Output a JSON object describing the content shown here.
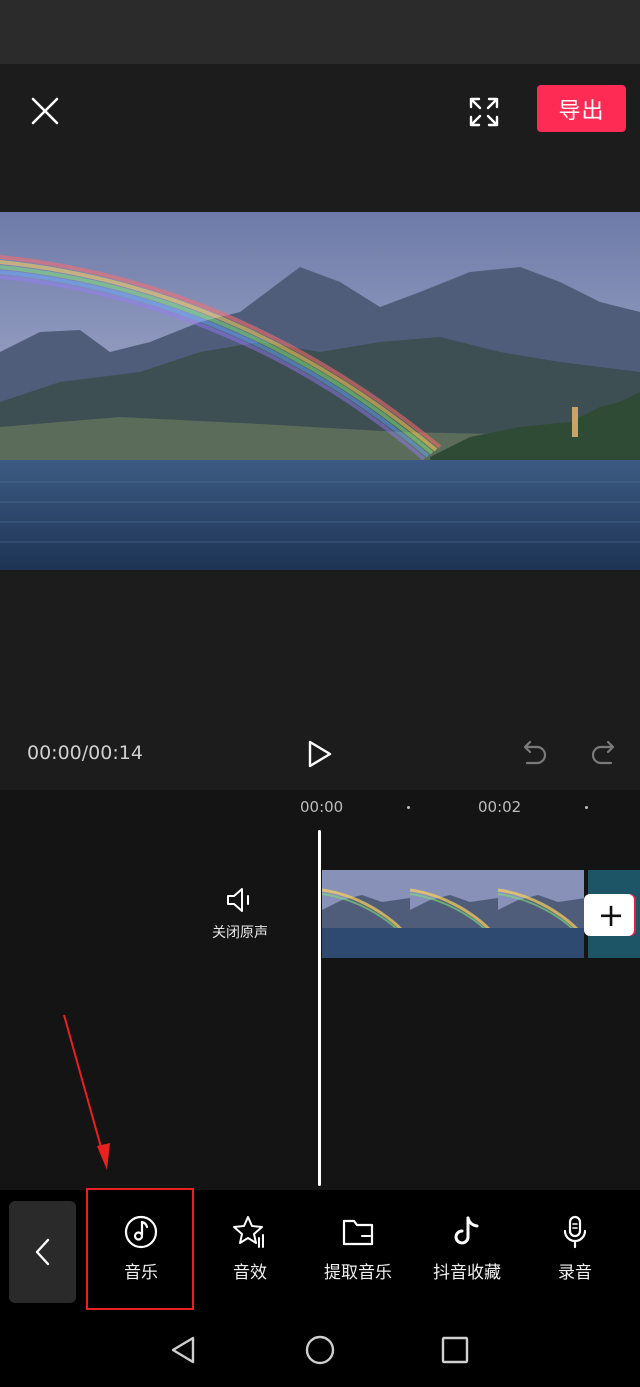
{
  "header": {
    "export_label": "导出"
  },
  "player": {
    "timecode": "00:00/00:14"
  },
  "timeline": {
    "ruler": [
      "00:00",
      "00:02"
    ],
    "mute_label": "关闭原声",
    "add_clip_label": "+"
  },
  "toolbar": {
    "items": [
      {
        "label": "音乐",
        "icon": "music-note-icon"
      },
      {
        "label": "音效",
        "icon": "sound-effect-icon"
      },
      {
        "label": "提取音乐",
        "icon": "folder-icon"
      },
      {
        "label": "抖音收藏",
        "icon": "tiktok-icon"
      },
      {
        "label": "录音",
        "icon": "microphone-icon"
      }
    ]
  },
  "colors": {
    "accent": "#fe2c55",
    "highlight": "#e8201e"
  }
}
